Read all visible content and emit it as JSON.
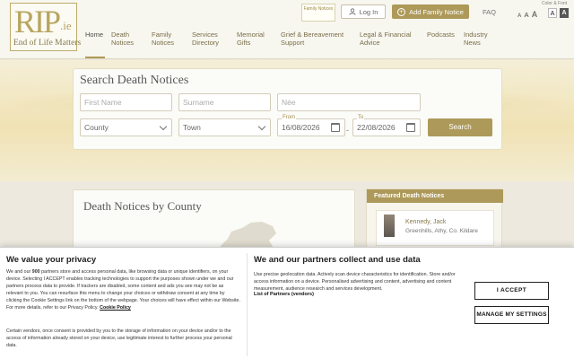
{
  "logo": {
    "mark": "RIP",
    "suffix": ".ie",
    "tagline": "End of Life Matters"
  },
  "header": {
    "promo_text": "Family Notices",
    "login_label": "Log In",
    "add_family_label": "Add Family Notice",
    "faq_label": "FAQ",
    "color_font_label": "Color & Font",
    "font_size_labels": [
      "A",
      "A",
      "A"
    ],
    "contrast_labels": [
      "A",
      "A"
    ]
  },
  "nav": {
    "items": [
      {
        "label": "Home"
      },
      {
        "label": "Death Notices"
      },
      {
        "label": "Family Notices"
      },
      {
        "label": "Services Directory"
      },
      {
        "label": "Memorial Gifts"
      },
      {
        "label": "Grief & Bereavement Support"
      },
      {
        "label": "Legal & Financial Advice"
      },
      {
        "label": "Podcasts"
      },
      {
        "label": "Industry News"
      }
    ]
  },
  "search": {
    "title": "Search Death Notices",
    "first_name_placeholder": "First Name",
    "surname_placeholder": "Surname",
    "nee_placeholder": "Née",
    "county_value": "County",
    "town_value": "Town",
    "from_label": "From",
    "from_value": "16/08/2026",
    "to_label": "To",
    "to_value": "22/08/2026",
    "range_separator": "-",
    "button_label": "Search"
  },
  "main": {
    "by_county_title": "Death Notices by County"
  },
  "featured": {
    "heading": "Featured Death Notices",
    "items": [
      {
        "name": "Kennedy, Jack",
        "location": "Greenhills, Athy, Co. Kildare"
      }
    ]
  },
  "consent": {
    "privacy_heading": "We value your privacy",
    "privacy_p1_a": "We and our ",
    "privacy_p1_count": "900",
    "privacy_p1_b": " partners store and access personal data, like browsing data or unique identifiers, on your device. Selecting I ACCEPT enables tracking technologies to support the purposes shown under we and our partners process data to provide. If trackers are disabled, some content and ads you see may not be as relevant to you. You can resurface this menu to change your choices or withdraw consent at any time by clicking the Cookie Settings link on the bottom of the webpage. Your choices will have effect within our Website. For more details, refer to our Privacy Policy.",
    "cookie_policy_label": "Cookie Policy",
    "privacy_p2": "Certain vendors, once consent is provided by you to the storage of information on your device and/or to the access of information already stored on your device, use legitimate interest to further process your personal data.",
    "partners_heading": "We and our partners collect and use data",
    "partners_p": "Use precise geolocation data. Actively scan device characteristics for identification. Store and/or access information on a device. Personalised advertising and content, advertising and content measurement, audience research and services development.",
    "partners_list_label": "List of Partners (vendors)",
    "accept_label": "I ACCEPT",
    "manage_label": "MANAGE MY SETTINGS"
  },
  "colors": {
    "accent": "#9b8335",
    "banner": "#eddca4",
    "text": "#333333"
  }
}
